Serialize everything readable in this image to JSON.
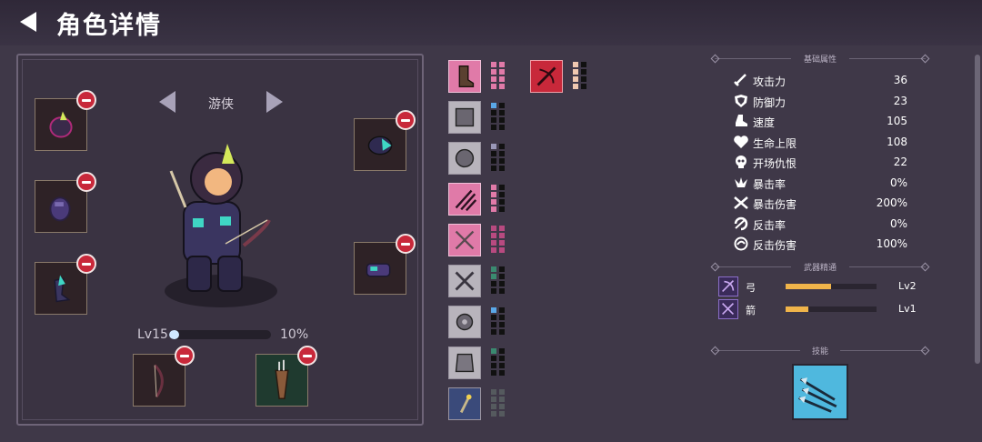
{
  "header": {
    "title": "角色详情"
  },
  "character": {
    "class_name": "游侠",
    "level_label": "Lv15",
    "xp_percent_label": "10%",
    "xp_fraction": 0.1
  },
  "sections": {
    "base_attributes": "基础属性",
    "weapon_mastery": "武器精通",
    "skills": "技能"
  },
  "stats": [
    {
      "label": "攻击力",
      "value": "36",
      "icon": "sword-icon"
    },
    {
      "label": "防御力",
      "value": "23",
      "icon": "shield-icon"
    },
    {
      "label": "速度",
      "value": "105",
      "icon": "boot-icon"
    },
    {
      "label": "生命上限",
      "value": "108",
      "icon": "heart-icon"
    },
    {
      "label": "开场仇恨",
      "value": "22",
      "icon": "skull-icon"
    },
    {
      "label": "暴击率",
      "value": "0%",
      "icon": "crit-burst-icon"
    },
    {
      "label": "暴击伤害",
      "value": "200%",
      "icon": "crossed-swords-icon"
    },
    {
      "label": "反击率",
      "value": "0%",
      "icon": "counter-icon"
    },
    {
      "label": "反击伤害",
      "value": "100%",
      "icon": "swirl-icon"
    }
  ],
  "weapons": [
    {
      "label": "弓",
      "level": "Lv2",
      "progress": 0.5,
      "icon": "bow-icon"
    },
    {
      "label": "箭",
      "level": "Lv1",
      "progress": 0.25,
      "icon": "arrows-icon"
    }
  ],
  "colors": {
    "background": "#3f3848",
    "remove_button": "#c8283a",
    "mastery_bar": "#f0b44a",
    "xp_bar": "#cfe8ff",
    "pink_rarity": "#e07aa8",
    "red_rarity": "#c8283a"
  }
}
